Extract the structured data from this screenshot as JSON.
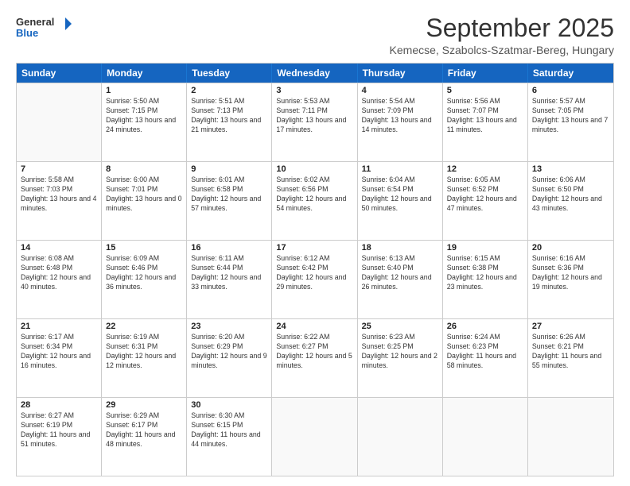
{
  "logo": {
    "line1": "General",
    "line2": "Blue"
  },
  "title": "September 2025",
  "subtitle": "Kemecse, Szabolcs-Szatmar-Bereg, Hungary",
  "header_days": [
    "Sunday",
    "Monday",
    "Tuesday",
    "Wednesday",
    "Thursday",
    "Friday",
    "Saturday"
  ],
  "rows": [
    [
      {
        "day": "",
        "sunrise": "",
        "sunset": "",
        "daylight": ""
      },
      {
        "day": "1",
        "sunrise": "Sunrise: 5:50 AM",
        "sunset": "Sunset: 7:15 PM",
        "daylight": "Daylight: 13 hours and 24 minutes."
      },
      {
        "day": "2",
        "sunrise": "Sunrise: 5:51 AM",
        "sunset": "Sunset: 7:13 PM",
        "daylight": "Daylight: 13 hours and 21 minutes."
      },
      {
        "day": "3",
        "sunrise": "Sunrise: 5:53 AM",
        "sunset": "Sunset: 7:11 PM",
        "daylight": "Daylight: 13 hours and 17 minutes."
      },
      {
        "day": "4",
        "sunrise": "Sunrise: 5:54 AM",
        "sunset": "Sunset: 7:09 PM",
        "daylight": "Daylight: 13 hours and 14 minutes."
      },
      {
        "day": "5",
        "sunrise": "Sunrise: 5:56 AM",
        "sunset": "Sunset: 7:07 PM",
        "daylight": "Daylight: 13 hours and 11 minutes."
      },
      {
        "day": "6",
        "sunrise": "Sunrise: 5:57 AM",
        "sunset": "Sunset: 7:05 PM",
        "daylight": "Daylight: 13 hours and 7 minutes."
      }
    ],
    [
      {
        "day": "7",
        "sunrise": "Sunrise: 5:58 AM",
        "sunset": "Sunset: 7:03 PM",
        "daylight": "Daylight: 13 hours and 4 minutes."
      },
      {
        "day": "8",
        "sunrise": "Sunrise: 6:00 AM",
        "sunset": "Sunset: 7:01 PM",
        "daylight": "Daylight: 13 hours and 0 minutes."
      },
      {
        "day": "9",
        "sunrise": "Sunrise: 6:01 AM",
        "sunset": "Sunset: 6:58 PM",
        "daylight": "Daylight: 12 hours and 57 minutes."
      },
      {
        "day": "10",
        "sunrise": "Sunrise: 6:02 AM",
        "sunset": "Sunset: 6:56 PM",
        "daylight": "Daylight: 12 hours and 54 minutes."
      },
      {
        "day": "11",
        "sunrise": "Sunrise: 6:04 AM",
        "sunset": "Sunset: 6:54 PM",
        "daylight": "Daylight: 12 hours and 50 minutes."
      },
      {
        "day": "12",
        "sunrise": "Sunrise: 6:05 AM",
        "sunset": "Sunset: 6:52 PM",
        "daylight": "Daylight: 12 hours and 47 minutes."
      },
      {
        "day": "13",
        "sunrise": "Sunrise: 6:06 AM",
        "sunset": "Sunset: 6:50 PM",
        "daylight": "Daylight: 12 hours and 43 minutes."
      }
    ],
    [
      {
        "day": "14",
        "sunrise": "Sunrise: 6:08 AM",
        "sunset": "Sunset: 6:48 PM",
        "daylight": "Daylight: 12 hours and 40 minutes."
      },
      {
        "day": "15",
        "sunrise": "Sunrise: 6:09 AM",
        "sunset": "Sunset: 6:46 PM",
        "daylight": "Daylight: 12 hours and 36 minutes."
      },
      {
        "day": "16",
        "sunrise": "Sunrise: 6:11 AM",
        "sunset": "Sunset: 6:44 PM",
        "daylight": "Daylight: 12 hours and 33 minutes."
      },
      {
        "day": "17",
        "sunrise": "Sunrise: 6:12 AM",
        "sunset": "Sunset: 6:42 PM",
        "daylight": "Daylight: 12 hours and 29 minutes."
      },
      {
        "day": "18",
        "sunrise": "Sunrise: 6:13 AM",
        "sunset": "Sunset: 6:40 PM",
        "daylight": "Daylight: 12 hours and 26 minutes."
      },
      {
        "day": "19",
        "sunrise": "Sunrise: 6:15 AM",
        "sunset": "Sunset: 6:38 PM",
        "daylight": "Daylight: 12 hours and 23 minutes."
      },
      {
        "day": "20",
        "sunrise": "Sunrise: 6:16 AM",
        "sunset": "Sunset: 6:36 PM",
        "daylight": "Daylight: 12 hours and 19 minutes."
      }
    ],
    [
      {
        "day": "21",
        "sunrise": "Sunrise: 6:17 AM",
        "sunset": "Sunset: 6:34 PM",
        "daylight": "Daylight: 12 hours and 16 minutes."
      },
      {
        "day": "22",
        "sunrise": "Sunrise: 6:19 AM",
        "sunset": "Sunset: 6:31 PM",
        "daylight": "Daylight: 12 hours and 12 minutes."
      },
      {
        "day": "23",
        "sunrise": "Sunrise: 6:20 AM",
        "sunset": "Sunset: 6:29 PM",
        "daylight": "Daylight: 12 hours and 9 minutes."
      },
      {
        "day": "24",
        "sunrise": "Sunrise: 6:22 AM",
        "sunset": "Sunset: 6:27 PM",
        "daylight": "Daylight: 12 hours and 5 minutes."
      },
      {
        "day": "25",
        "sunrise": "Sunrise: 6:23 AM",
        "sunset": "Sunset: 6:25 PM",
        "daylight": "Daylight: 12 hours and 2 minutes."
      },
      {
        "day": "26",
        "sunrise": "Sunrise: 6:24 AM",
        "sunset": "Sunset: 6:23 PM",
        "daylight": "Daylight: 11 hours and 58 minutes."
      },
      {
        "day": "27",
        "sunrise": "Sunrise: 6:26 AM",
        "sunset": "Sunset: 6:21 PM",
        "daylight": "Daylight: 11 hours and 55 minutes."
      }
    ],
    [
      {
        "day": "28",
        "sunrise": "Sunrise: 6:27 AM",
        "sunset": "Sunset: 6:19 PM",
        "daylight": "Daylight: 11 hours and 51 minutes."
      },
      {
        "day": "29",
        "sunrise": "Sunrise: 6:29 AM",
        "sunset": "Sunset: 6:17 PM",
        "daylight": "Daylight: 11 hours and 48 minutes."
      },
      {
        "day": "30",
        "sunrise": "Sunrise: 6:30 AM",
        "sunset": "Sunset: 6:15 PM",
        "daylight": "Daylight: 11 hours and 44 minutes."
      },
      {
        "day": "",
        "sunrise": "",
        "sunset": "",
        "daylight": ""
      },
      {
        "day": "",
        "sunrise": "",
        "sunset": "",
        "daylight": ""
      },
      {
        "day": "",
        "sunrise": "",
        "sunset": "",
        "daylight": ""
      },
      {
        "day": "",
        "sunrise": "",
        "sunset": "",
        "daylight": ""
      }
    ]
  ]
}
